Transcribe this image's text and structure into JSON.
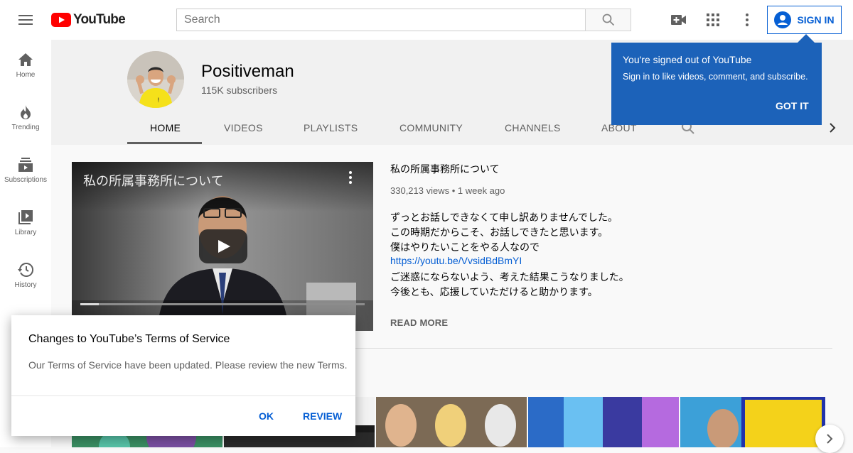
{
  "header": {
    "logo_text": "YouTube",
    "search_placeholder": "Search",
    "sign_in_label": "SIGN IN",
    "icons": [
      "menu-icon",
      "youtube-logo-icon",
      "search-icon",
      "create-video-icon",
      "apps-grid-icon",
      "more-vert-icon",
      "account-circle-icon"
    ]
  },
  "sidebar": {
    "items": [
      {
        "label": "Home",
        "icon": "home-icon"
      },
      {
        "label": "Trending",
        "icon": "flame-icon"
      },
      {
        "label": "Subscriptions",
        "icon": "subscriptions-icon"
      },
      {
        "label": "Library",
        "icon": "library-icon"
      },
      {
        "label": "History",
        "icon": "history-icon"
      }
    ]
  },
  "channel": {
    "name": "Positiveman",
    "subscribers": "115K subscribers",
    "tabs": [
      "HOME",
      "VIDEOS",
      "PLAYLISTS",
      "COMMUNITY",
      "CHANNELS",
      "ABOUT"
    ],
    "active_tab": "HOME"
  },
  "featured": {
    "overlay_title": "私の所属事務所について",
    "title": "私の所属事務所について",
    "meta": "330,213 views • 1 week ago",
    "description": [
      "ずっとお話しできなくて申し訳ありませんでした。",
      "この時期だからこそ、お話しできたと思います。",
      "僕はやりたいことをやる人なので",
      "https://youtu.be/VvsidBdBmYI",
      "ご迷惑にならないよう、考えた結果こうなりました。",
      "今後とも、応援していただけると助かります。"
    ],
    "read_more": "READ MORE"
  },
  "tooltip": {
    "title": "You're signed out of YouTube",
    "body": "Sign in to like videos, comment, and subscribe.",
    "button": "GOT IT"
  },
  "dialog": {
    "title": "Changes to YouTube’s Terms of Service",
    "body": "Our Terms of Service have been updated. Please review the new Terms.",
    "ok_label": "OK",
    "review_label": "REVIEW"
  },
  "colors": {
    "brand_red": "#ff0000",
    "link_blue": "#065fd4",
    "tooltip_blue": "#1c62b9"
  }
}
